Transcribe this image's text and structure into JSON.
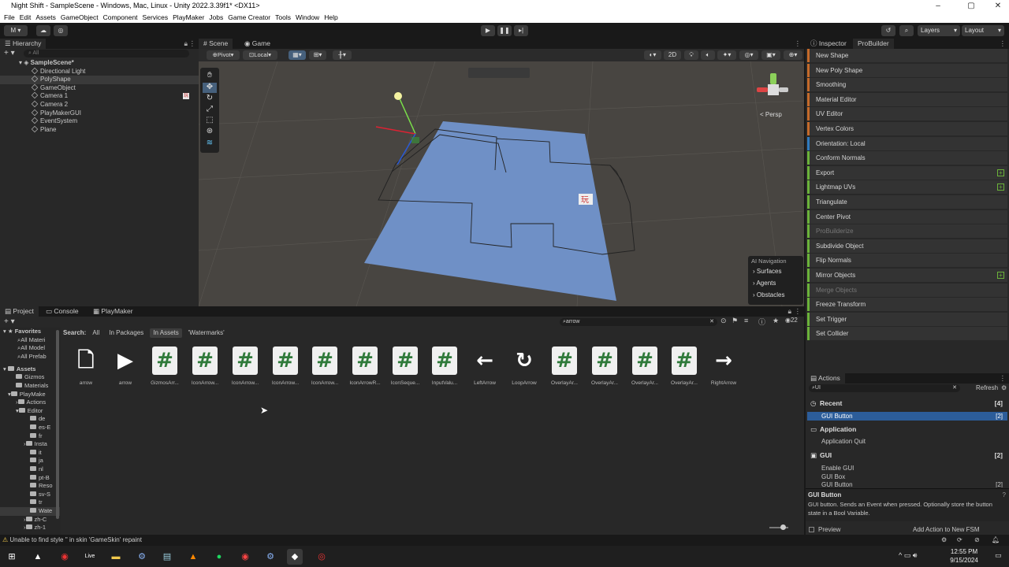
{
  "window": {
    "title": "Night Shift - SampleScene - Windows, Mac, Linux - Unity 2022.3.39f1* <DX11>"
  },
  "menu": [
    "File",
    "Edit",
    "Assets",
    "GameObject",
    "Component",
    "Services",
    "PlayMaker",
    "Jobs",
    "Game Creator",
    "Tools",
    "Window",
    "Help"
  ],
  "toolbar": {
    "account": "M",
    "layers": "Layers",
    "layout": "Layout"
  },
  "hierarchy": {
    "tab": "Hierarchy",
    "search_placeholder": "All",
    "scene": "SampleScene*",
    "items": [
      "Directional Light",
      "PolyShape",
      "GameObject",
      "Camera 1",
      "Camera 2",
      "PlayMakerGUI",
      "EventSystem",
      "Plane"
    ]
  },
  "scene": {
    "tabs": [
      "Scene",
      "Game"
    ],
    "pivot": "Pivot",
    "local": "Local",
    "mode_2d": "2D",
    "persp": "< Persp",
    "ai_nav": {
      "title": "AI Navigation",
      "items": [
        "Surfaces",
        "Agents",
        "Obstacles"
      ]
    }
  },
  "inspector": {
    "tabs": [
      "Inspector",
      "ProBuilder"
    ],
    "items": [
      {
        "label": "New Shape",
        "color": "o",
        "plus": false
      },
      {
        "label": "New Poly Shape",
        "color": "o",
        "plus": false
      },
      {
        "label": "Smoothing",
        "color": "o",
        "plus": false
      },
      {
        "label": "Material Editor",
        "color": "o",
        "plus": false
      },
      {
        "label": "UV Editor",
        "color": "o",
        "plus": false
      },
      {
        "label": "Vertex Colors",
        "color": "o",
        "plus": false
      },
      {
        "label": "Orientation: Local",
        "color": "b",
        "plus": false
      },
      {
        "label": "Conform Normals",
        "color": "g",
        "plus": false
      },
      {
        "label": "Export",
        "color": "g",
        "plus": true
      },
      {
        "label": "Lightmap UVs",
        "color": "g",
        "plus": true
      },
      {
        "label": "Triangulate",
        "color": "g",
        "plus": false
      },
      {
        "label": "Center Pivot",
        "color": "g",
        "plus": false
      },
      {
        "label": "ProBuilderize",
        "color": "g",
        "plus": false,
        "disabled": true
      },
      {
        "label": "Subdivide Object",
        "color": "g",
        "plus": false
      },
      {
        "label": "Flip Normals",
        "color": "g",
        "plus": false
      },
      {
        "label": "Mirror Objects",
        "color": "g",
        "plus": true
      },
      {
        "label": "Merge Objects",
        "color": "g",
        "plus": false,
        "disabled": true
      },
      {
        "label": "Freeze Transform",
        "color": "g",
        "plus": false
      },
      {
        "label": "Set Trigger",
        "color": "g",
        "plus": false
      },
      {
        "label": "Set Collider",
        "color": "g",
        "plus": false
      }
    ]
  },
  "project": {
    "tabs": [
      "Project",
      "Console",
      "PlayMaker"
    ],
    "search_value": "arrow",
    "search_label": "Search:",
    "filters": [
      "All",
      "In Packages",
      "In Assets",
      "'Watermarks'"
    ],
    "count": "22",
    "tree": [
      "Favorites",
      "All Materi",
      "All Model",
      "All Prefab",
      "Assets",
      "Gizmos",
      "Materials",
      "PlayMake",
      "Actions",
      "Editor",
      "de",
      "es-E",
      "fr",
      "Insta",
      "it",
      "ja",
      "nl",
      "pt-B",
      "Reso",
      "sv-S",
      "tr",
      "Wate",
      "zh-C",
      "zh-1"
    ],
    "assets": [
      {
        "label": "arrow",
        "icon": "doc"
      },
      {
        "label": "arrow",
        "icon": "play"
      },
      {
        "label": "GizmosArr...",
        "icon": "hash"
      },
      {
        "label": "IconArrow...",
        "icon": "hash"
      },
      {
        "label": "IconArrow...",
        "icon": "hash"
      },
      {
        "label": "IconArrow...",
        "icon": "hash"
      },
      {
        "label": "IconArrow...",
        "icon": "hash"
      },
      {
        "label": "IconArrowR...",
        "icon": "hash"
      },
      {
        "label": "IconSeque...",
        "icon": "hash"
      },
      {
        "label": "InputValu...",
        "icon": "hash"
      },
      {
        "label": "LeftArrow",
        "icon": "left"
      },
      {
        "label": "LoopArrow",
        "icon": "loop"
      },
      {
        "label": "OverlayAr...",
        "icon": "hash"
      },
      {
        "label": "OverlayAr...",
        "icon": "hash"
      },
      {
        "label": "OverlayAr...",
        "icon": "hash"
      },
      {
        "label": "OverlayAr...",
        "icon": "hash"
      },
      {
        "label": "RightArrow",
        "icon": "right"
      }
    ]
  },
  "actions": {
    "tab": "Actions",
    "search_value": "UI",
    "refresh": "Refresh",
    "recent": {
      "label": "Recent",
      "count": "[4]"
    },
    "gui_button_sel": {
      "label": "GUI Button",
      "count": "[2]"
    },
    "application": {
      "label": "Application"
    },
    "application_quit": "Application Quit",
    "gui": {
      "label": "GUI",
      "count": "[2]"
    },
    "gui_items": [
      "Enable GUI",
      "GUI Box",
      "GUI Button"
    ],
    "gui_items_count": "[2]",
    "desc_title": "GUI Button",
    "desc_text": "GUI button. Sends an Event when pressed. Optionally store the button state in a Bool Variable.",
    "preview": "Preview",
    "add_action": "Add Action to New FSM"
  },
  "status": {
    "message": "Unable to find style '' in skin 'GameSkin' repaint"
  },
  "taskbar": {
    "time": "12:55 PM",
    "date": "9/15/2024",
    "live": "Live"
  }
}
